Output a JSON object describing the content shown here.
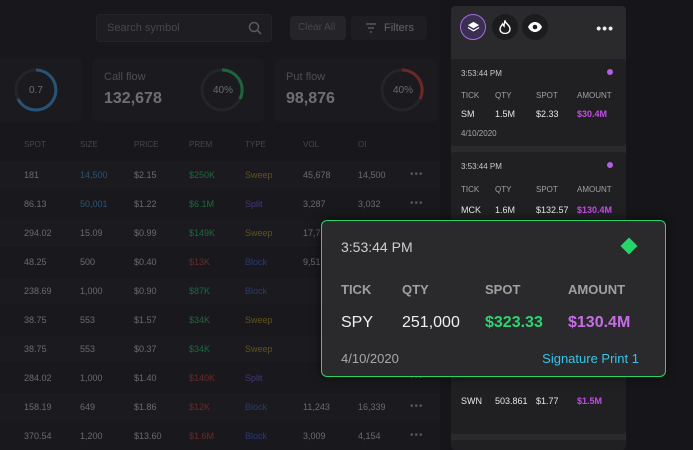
{
  "toolbar": {
    "search_placeholder": "Search symbol",
    "ghost_label": "Clear All",
    "filters_label": "Filters"
  },
  "stats": [
    {
      "label": "",
      "value": "",
      "ring": "0.7",
      "ring_color": "#3fa9f5"
    },
    {
      "label": "Call flow",
      "value": "132,678",
      "ring": "40%",
      "ring_color": "#27d46a"
    },
    {
      "label": "Put flow",
      "value": "98,876",
      "ring": "40%",
      "ring_color": "#e0413b"
    }
  ],
  "table": {
    "headers": [
      "SPOT",
      "SIZE",
      "PRICE",
      "PREM",
      "TYPE",
      "VOL",
      "OI"
    ],
    "rows": [
      {
        "spot": "181",
        "size": "14,500",
        "price": "$2.15",
        "prem": "$250K",
        "type": "Sweep",
        "vol": "45,678",
        "oi": "14,500",
        "size_color": "#3fa9f5",
        "prem_color": "#27d46a",
        "type_color": "#c9a227"
      },
      {
        "spot": "86.13",
        "size": "50,001",
        "price": "$1.22",
        "prem": "$6.1M",
        "type": "Split",
        "vol": "3,287",
        "oi": "3,032",
        "size_color": "#3fa9f5",
        "prem_color": "#27d46a",
        "type_color": "#8a5cf5"
      },
      {
        "spot": "294.02",
        "size": "15.09",
        "price": "$0.99",
        "prem": "$149K",
        "type": "Sweep",
        "vol": "17,753",
        "oi": "",
        "size_color": "#ddd",
        "prem_color": "#27d46a",
        "type_color": "#c9a227"
      },
      {
        "spot": "48.25",
        "size": "500",
        "price": "$0.40",
        "prem": "$13K",
        "type": "Block",
        "vol": "9,517",
        "oi": "",
        "size_color": "#ddd",
        "prem_color": "#e0413b",
        "type_color": "#3f6af5"
      },
      {
        "spot": "238.69",
        "size": "1,000",
        "price": "$0.90",
        "prem": "$87K",
        "type": "Block",
        "vol": "",
        "oi": "",
        "size_color": "#ddd",
        "prem_color": "#27d46a",
        "type_color": "#3f6af5"
      },
      {
        "spot": "38.75",
        "size": "553",
        "price": "$1.57",
        "prem": "$34K",
        "type": "Sweep",
        "vol": "",
        "oi": "",
        "size_color": "#ddd",
        "prem_color": "#27d46a",
        "type_color": "#c9a227"
      },
      {
        "spot": "38.75",
        "size": "553",
        "price": "$0.37",
        "prem": "$34K",
        "type": "Sweep",
        "vol": "",
        "oi": "",
        "size_color": "#ddd",
        "prem_color": "#27d46a",
        "type_color": "#c9a227"
      },
      {
        "spot": "284.02",
        "size": "1,000",
        "price": "$1.40",
        "prem": "$140K",
        "type": "Split",
        "vol": "",
        "oi": "",
        "size_color": "#ddd",
        "prem_color": "#e0413b",
        "type_color": "#8a5cf5"
      },
      {
        "spot": "158.19",
        "size": "649",
        "price": "$1.86",
        "prem": "$12K",
        "type": "Block",
        "vol": "11,243",
        "oi": "16,339",
        "size_color": "#ddd",
        "prem_color": "#e0413b",
        "type_color": "#3f6af5"
      },
      {
        "spot": "370.54",
        "size": "1,200",
        "price": "$13.60",
        "prem": "$1.6M",
        "type": "Block",
        "vol": "3,009",
        "oi": "4,154",
        "size_color": "#ddd",
        "prem_color": "#e0413b",
        "type_color": "#3f6af5"
      }
    ]
  },
  "panel": {
    "icons": [
      "layers-icon",
      "flame-icon",
      "eye-icon"
    ],
    "more": "•••",
    "cards": [
      {
        "time": "3:53:44 PM",
        "tick": "SM",
        "qty": "1.5M",
        "spot": "$2.33",
        "amount": "$30.4M",
        "date": "4/10/2020"
      },
      {
        "time": "3:53:44 PM",
        "tick": "MCK",
        "qty": "1.6M",
        "spot": "$132.57",
        "amount": "$130.4M",
        "date": ""
      }
    ],
    "bottom_card": {
      "tick": "SWN",
      "qty": "503.861",
      "spot": "$1.77",
      "amount": "$1.5M"
    },
    "headers": [
      "TICK",
      "QTY",
      "SPOT",
      "AMOUNT"
    ]
  },
  "popup": {
    "time": "3:53:44 PM",
    "headers": [
      "TICK",
      "QTY",
      "SPOT",
      "AMOUNT"
    ],
    "tick": "SPY",
    "qty": "251,000",
    "spot": "$323.33",
    "amount": "$130.4M",
    "date": "4/10/2020",
    "label": "Signature Print 1"
  },
  "colors": {
    "accent_green": "#27d46a",
    "accent_purple": "#c24ce6",
    "accent_cyan": "#38c3e8"
  }
}
